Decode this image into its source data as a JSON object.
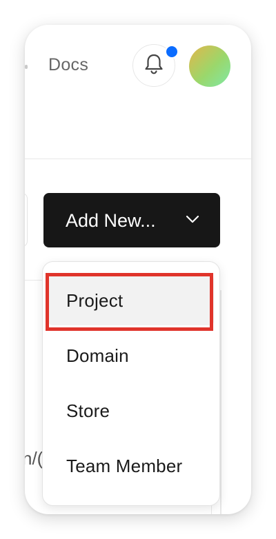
{
  "header": {
    "nav_docs": "Docs",
    "notification_dot_color": "#0b6cff",
    "bell_icon": "bell-icon",
    "avatar_gradient": [
      "#e2b64a",
      "#9bd76b",
      "#7fe8a6"
    ]
  },
  "toolbar": {
    "add_new_label": "Add New...",
    "chevron_icon": "chevron-down-icon",
    "button_color": "#171717"
  },
  "dropdown": {
    "items": [
      {
        "label": "Project",
        "highlighted": true
      },
      {
        "label": "Domain",
        "highlighted": false
      },
      {
        "label": "Store",
        "highlighted": false
      },
      {
        "label": "Team Member",
        "highlighted": false
      }
    ],
    "highlight_color": "#e0342b"
  },
  "background": {
    "partial_text": "n/("
  }
}
